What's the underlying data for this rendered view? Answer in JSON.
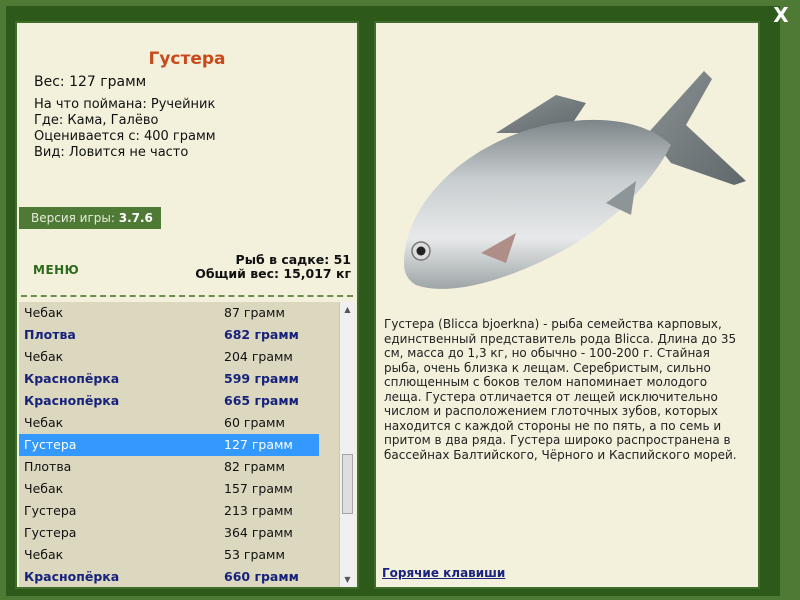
{
  "fish": {
    "name": "Густера",
    "weight": "Вес: 127 грамм",
    "bait": "На что поймана: Ручейник",
    "place": "Где: Кама, Галёво",
    "rating": "Оценивается с: 400 грамм",
    "rarity": "Вид: Ловится не часто",
    "description": "Густера (Blicca bjoerkna) - рыба семейства карповых, единственный представитель рода Blicca. Длина до 35 см, масса до 1,3 кг, но обычно - 100-200 г. Стайная рыба, очень близка к лещам. Серебристым, сильно сплющенным с боков телом напоминает молодого леща. Густера отличается от лещей исключительно числом и расположением глоточных зубов, которых находится с каждой стороны не по пять, а по семь и притом в два ряда. Густера широко распространена в бассейнах Балтийского, Чёрного и Каспийского морей."
  },
  "version": {
    "label": "Версия игры:",
    "value": "3.7.6"
  },
  "menu_label": "МЕНЮ",
  "stats": {
    "fish_count": "Рыб в садке: 51",
    "total_weight": "Общий вес: 15,017 кг"
  },
  "catch_list": [
    {
      "name": "Чебак",
      "weight": "87 грамм",
      "big": false,
      "selected": false
    },
    {
      "name": "Плотва",
      "weight": "682 грамм",
      "big": true,
      "selected": false
    },
    {
      "name": "Чебак",
      "weight": "204 грамм",
      "big": false,
      "selected": false
    },
    {
      "name": "Краснопёрка",
      "weight": "599 грамм",
      "big": true,
      "selected": false
    },
    {
      "name": "Краснопёрка",
      "weight": "665 грамм",
      "big": true,
      "selected": false
    },
    {
      "name": "Чебак",
      "weight": "60 грамм",
      "big": false,
      "selected": false
    },
    {
      "name": "Густера",
      "weight": "127 грамм",
      "big": false,
      "selected": true
    },
    {
      "name": "Плотва",
      "weight": "82 грамм",
      "big": false,
      "selected": false
    },
    {
      "name": "Чебак",
      "weight": "157 грамм",
      "big": false,
      "selected": false
    },
    {
      "name": "Густера",
      "weight": "213 грамм",
      "big": false,
      "selected": false
    },
    {
      "name": "Густера",
      "weight": "364 грамм",
      "big": false,
      "selected": false
    },
    {
      "name": "Чебак",
      "weight": "53 грамм",
      "big": false,
      "selected": false
    },
    {
      "name": "Краснопёрка",
      "weight": "660 грамм",
      "big": true,
      "selected": false
    }
  ],
  "hotkeys_label": "Горячие клавиши",
  "close_label": "X",
  "colors": {
    "frame": "#2d5a1a",
    "panel": "#f3f0dc",
    "title": "#c84a1a",
    "trophy_text": "#17227a",
    "selection": "#3399ff"
  }
}
